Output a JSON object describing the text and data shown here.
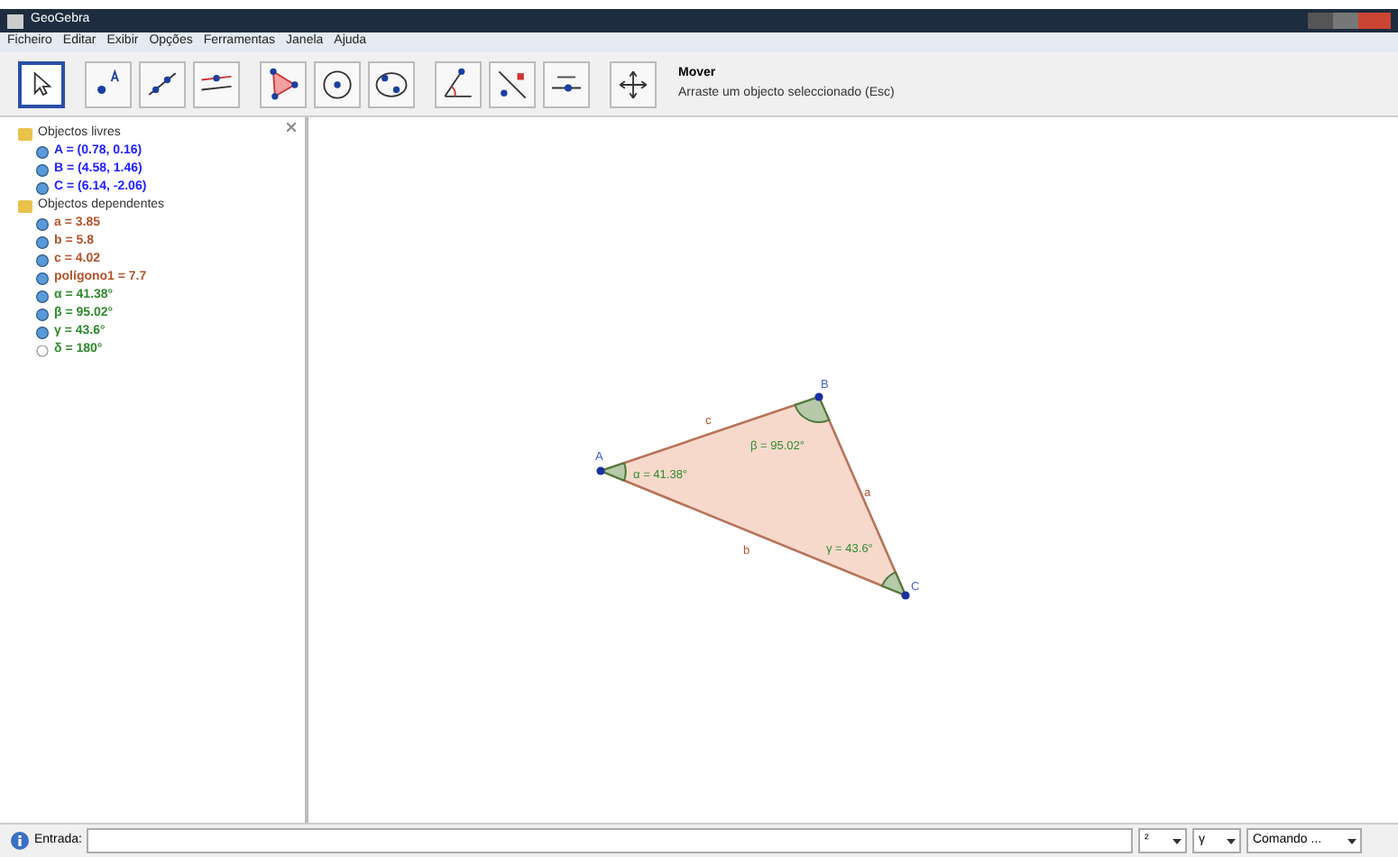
{
  "window": {
    "title": "GeoGebra"
  },
  "menu": [
    "Ficheiro",
    "Editar",
    "Exibir",
    "Opções",
    "Ferramentas",
    "Janela",
    "Ajuda"
  ],
  "tools": [
    {
      "kind": "move",
      "selected": true
    },
    {
      "kind": "point",
      "selected": false
    },
    {
      "kind": "line",
      "selected": false
    },
    {
      "kind": "parallel",
      "selected": false
    },
    {
      "kind": "polygon",
      "selected": false
    },
    {
      "kind": "circle",
      "selected": false
    },
    {
      "kind": "conic",
      "selected": false
    },
    {
      "kind": "angle",
      "selected": false
    },
    {
      "kind": "reflect",
      "selected": false
    },
    {
      "kind": "slider",
      "selected": false
    },
    {
      "kind": "pan",
      "selected": false
    }
  ],
  "tool_help": {
    "name": "Mover",
    "hint": "Arraste um objecto seleccionado (Esc)"
  },
  "algebra": [
    {
      "label": "Objectos livres",
      "children": [
        {
          "text": "A = (0.78, 0.16)",
          "color": "#2020ff",
          "visible": true
        },
        {
          "text": "B = (4.58, 1.46)",
          "color": "#2020ff",
          "visible": true
        },
        {
          "text": "C = (6.14, -2.06)",
          "color": "#2020ff",
          "visible": true
        }
      ]
    },
    {
      "label": "Objectos dependentes",
      "children": [
        {
          "text": "a = 3.85",
          "color": "#b5532a",
          "visible": true
        },
        {
          "text": "b = 5.8",
          "color": "#b5532a",
          "visible": true
        },
        {
          "text": "c = 4.02",
          "color": "#b5532a",
          "visible": true
        },
        {
          "text": "polígono1 = 7.7",
          "color": "#b5532a",
          "visible": true
        },
        {
          "text": "α = 41.38°",
          "color": "#2e8b2e",
          "visible": true
        },
        {
          "text": "β = 95.02°",
          "color": "#2e8b2e",
          "visible": true
        },
        {
          "text": "γ = 43.6°",
          "color": "#2e8b2e",
          "visible": true
        },
        {
          "text": "δ = 180°",
          "color": "#2e8b2e",
          "visible": false
        }
      ]
    }
  ],
  "graphics": {
    "points": [
      "A",
      "B",
      "C"
    ],
    "sides": [
      "a",
      "b",
      "c"
    ],
    "angles": [
      "α = 41.38°",
      "β = 95.02°",
      "γ = 43.6°"
    ]
  },
  "input_bar": {
    "label": "Entrada:",
    "dropdowns": [
      "²",
      "γ",
      "Comando ..."
    ]
  }
}
